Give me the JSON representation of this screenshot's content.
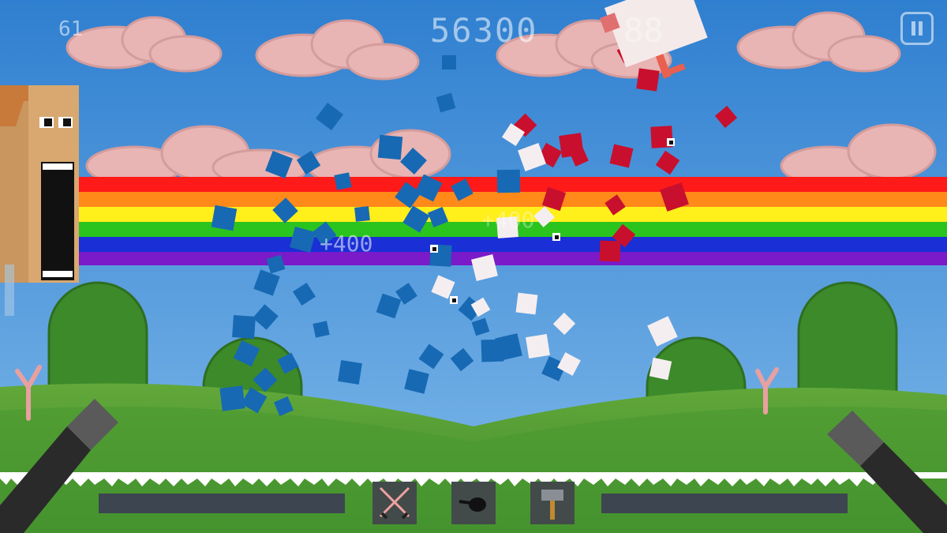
{
  "hud": {
    "fps": "61",
    "score": "56300",
    "ghost_score": "88",
    "pause_icon": "pause-icon"
  },
  "popups": {
    "points_1": "+400",
    "points_2": "+400"
  },
  "weapons": [
    {
      "name": "crossed-swords-icon"
    },
    {
      "name": "frying-pan-icon"
    },
    {
      "name": "hammer-icon"
    }
  ],
  "colors": {
    "sky": "#3d8fd6",
    "rainbow": [
      "#ff1a1a",
      "#ff8a1a",
      "#ffef1a",
      "#2bc41f",
      "#1a2fd6",
      "#7a1ac9"
    ],
    "grass": "#4f9a2f",
    "bird_blue": "#1769b3",
    "bird_red": "#c8102e"
  }
}
